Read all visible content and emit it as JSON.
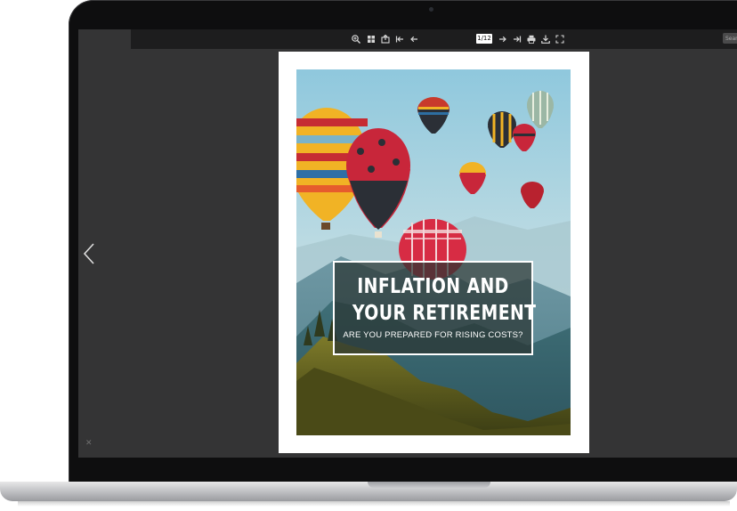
{
  "toolbar": {
    "icons": [
      "zoom-in-icon",
      "thumbnails-icon",
      "share-icon",
      "first-page-icon",
      "previous-page-icon",
      "next-page-icon",
      "last-page-icon",
      "print-icon",
      "download-icon",
      "fullscreen-icon"
    ],
    "page_indicator": "1/12",
    "search_placeholder": "Search"
  },
  "document": {
    "cover_title_line1": "INFLATION AND",
    "cover_title_line2": "YOUR RETIREMENT",
    "cover_subtitle": "ARE YOU PREPARED FOR RISING COSTS?"
  },
  "colors": {
    "screen_bg": "#343435",
    "toolbar_bg": "#1d1d1e",
    "title_box_bg": "#2a3432",
    "balloon_red": "#c8263a",
    "balloon_yellow": "#f0b323",
    "sky": "#9ecfe2"
  }
}
